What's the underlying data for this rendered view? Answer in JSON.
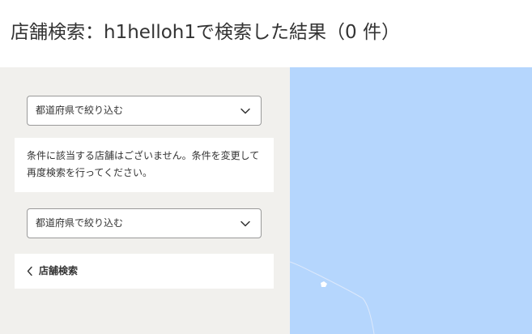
{
  "header": {
    "title": "店舗検索：h1helloh1で検索した結果（0 件）"
  },
  "sidebar": {
    "prefecture_filter_top": {
      "label": "都道府県で絞り込む",
      "icon": "chevron-down-icon"
    },
    "notice": "条件に該当する店舗はございません。条件を変更して再度検索を行ってください。",
    "prefecture_filter_bottom": {
      "label": "都道府県で絞り込む",
      "icon": "chevron-down-icon"
    },
    "back_link": {
      "label": "店舗検索",
      "icon": "chevron-left-icon"
    }
  },
  "map": {
    "water_color": "#b5d6fd",
    "land_color": "#ffffff"
  }
}
